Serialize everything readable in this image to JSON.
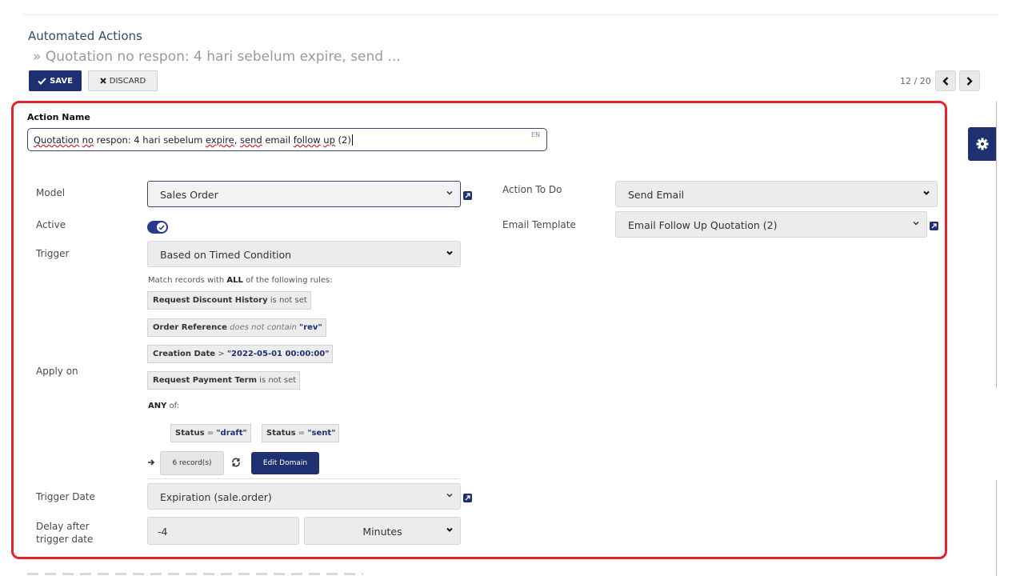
{
  "breadcrumb": {
    "root": "Automated Actions",
    "separator": "»",
    "current": "Quotation no respon: 4 hari sebelum expire, send ..."
  },
  "buttons": {
    "save": "SAVE",
    "discard": "DISCARD",
    "edit_domain": "Edit Domain",
    "records": "6 record(s)"
  },
  "pager": {
    "value": "12 / 20",
    "prev_icon": "chevron-left-icon",
    "next_icon": "chevron-right-icon"
  },
  "form": {
    "action_name_label": "Action Name",
    "action_name_value_parts": [
      "Quotation",
      " ",
      "no",
      " respon: 4 hari sebelum ",
      "expire",
      ", ",
      "send",
      " email ",
      "follow",
      " ",
      "up",
      " (2)"
    ],
    "lang": "EN",
    "model_label": "Model",
    "model_value": "Sales Order",
    "active_label": "Active",
    "active": true,
    "trigger_label": "Trigger",
    "trigger_value": "Based on Timed Condition",
    "apply_on_label": "Apply on",
    "trigger_date_label": "Trigger Date",
    "trigger_date_value": "Expiration (sale.order)",
    "delay_label_line1": "Delay after",
    "delay_label_line2": "trigger date",
    "delay_value": "-4",
    "delay_unit": "Minutes",
    "action_todo_label": "Action To Do",
    "action_todo_value": "Send Email",
    "email_template_label": "Email Template",
    "email_template_value": "Email Follow Up Quotation (2)"
  },
  "domain": {
    "intro_prefix": "Match records with ",
    "intro_bold": "ALL",
    "intro_suffix": " of the following rules:",
    "rules": [
      {
        "field": "Request Discount History",
        "op": " is not set",
        "value": ""
      },
      {
        "field": "Order Reference",
        "op": " does not contain ",
        "value": "\"rev\""
      },
      {
        "field": "Creation Date",
        "op": " > ",
        "value": "\"2022-05-01 00:00:00\""
      },
      {
        "field": "Request Payment Term",
        "op": " is not set",
        "value": ""
      }
    ],
    "any_bold": "ANY",
    "any_suffix": " of:",
    "any_rules": [
      {
        "field": "Status",
        "op": " = ",
        "value": "\"draft\""
      },
      {
        "field": "Status",
        "op": " = ",
        "value": "\"sent\""
      }
    ]
  },
  "colors": {
    "primary": "#1f3070",
    "highlight_border": "#e3242b"
  }
}
